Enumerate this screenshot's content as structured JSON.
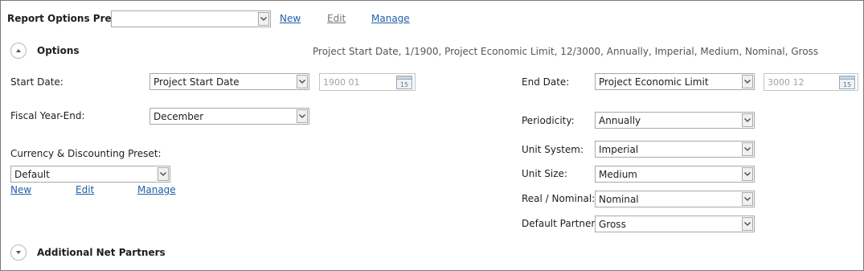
{
  "preset": {
    "label": "Report Options Preset:",
    "value": "",
    "new": "New",
    "edit": "Edit",
    "manage": "Manage"
  },
  "options": {
    "title": "Options",
    "summary": "Project Start Date, 1/1900, Project Economic Limit, 12/3000, Annually, Imperial, Medium, Nominal, Gross"
  },
  "start_date": {
    "label": "Start Date:",
    "value": "Project Start Date",
    "date": "1900 01"
  },
  "end_date": {
    "label": "End Date:",
    "value": "Project Economic Limit",
    "date": "3000 12"
  },
  "fiscal": {
    "label": "Fiscal Year-End:",
    "value": "December"
  },
  "periodicity": {
    "label": "Periodicity:",
    "value": "Annually"
  },
  "currency": {
    "label": "Currency & Discounting Preset:",
    "value": "Default",
    "new": "New",
    "edit": "Edit",
    "manage": "Manage"
  },
  "unit_system": {
    "label": "Unit System:",
    "value": "Imperial"
  },
  "unit_size": {
    "label": "Unit Size:",
    "value": "Medium"
  },
  "real_nominal": {
    "label": "Real / Nominal:",
    "value": "Nominal"
  },
  "default_partner": {
    "label": "Default Partner:",
    "value": "Gross"
  },
  "additional": {
    "title": "Additional Net Partners"
  },
  "calendar_day": "15"
}
